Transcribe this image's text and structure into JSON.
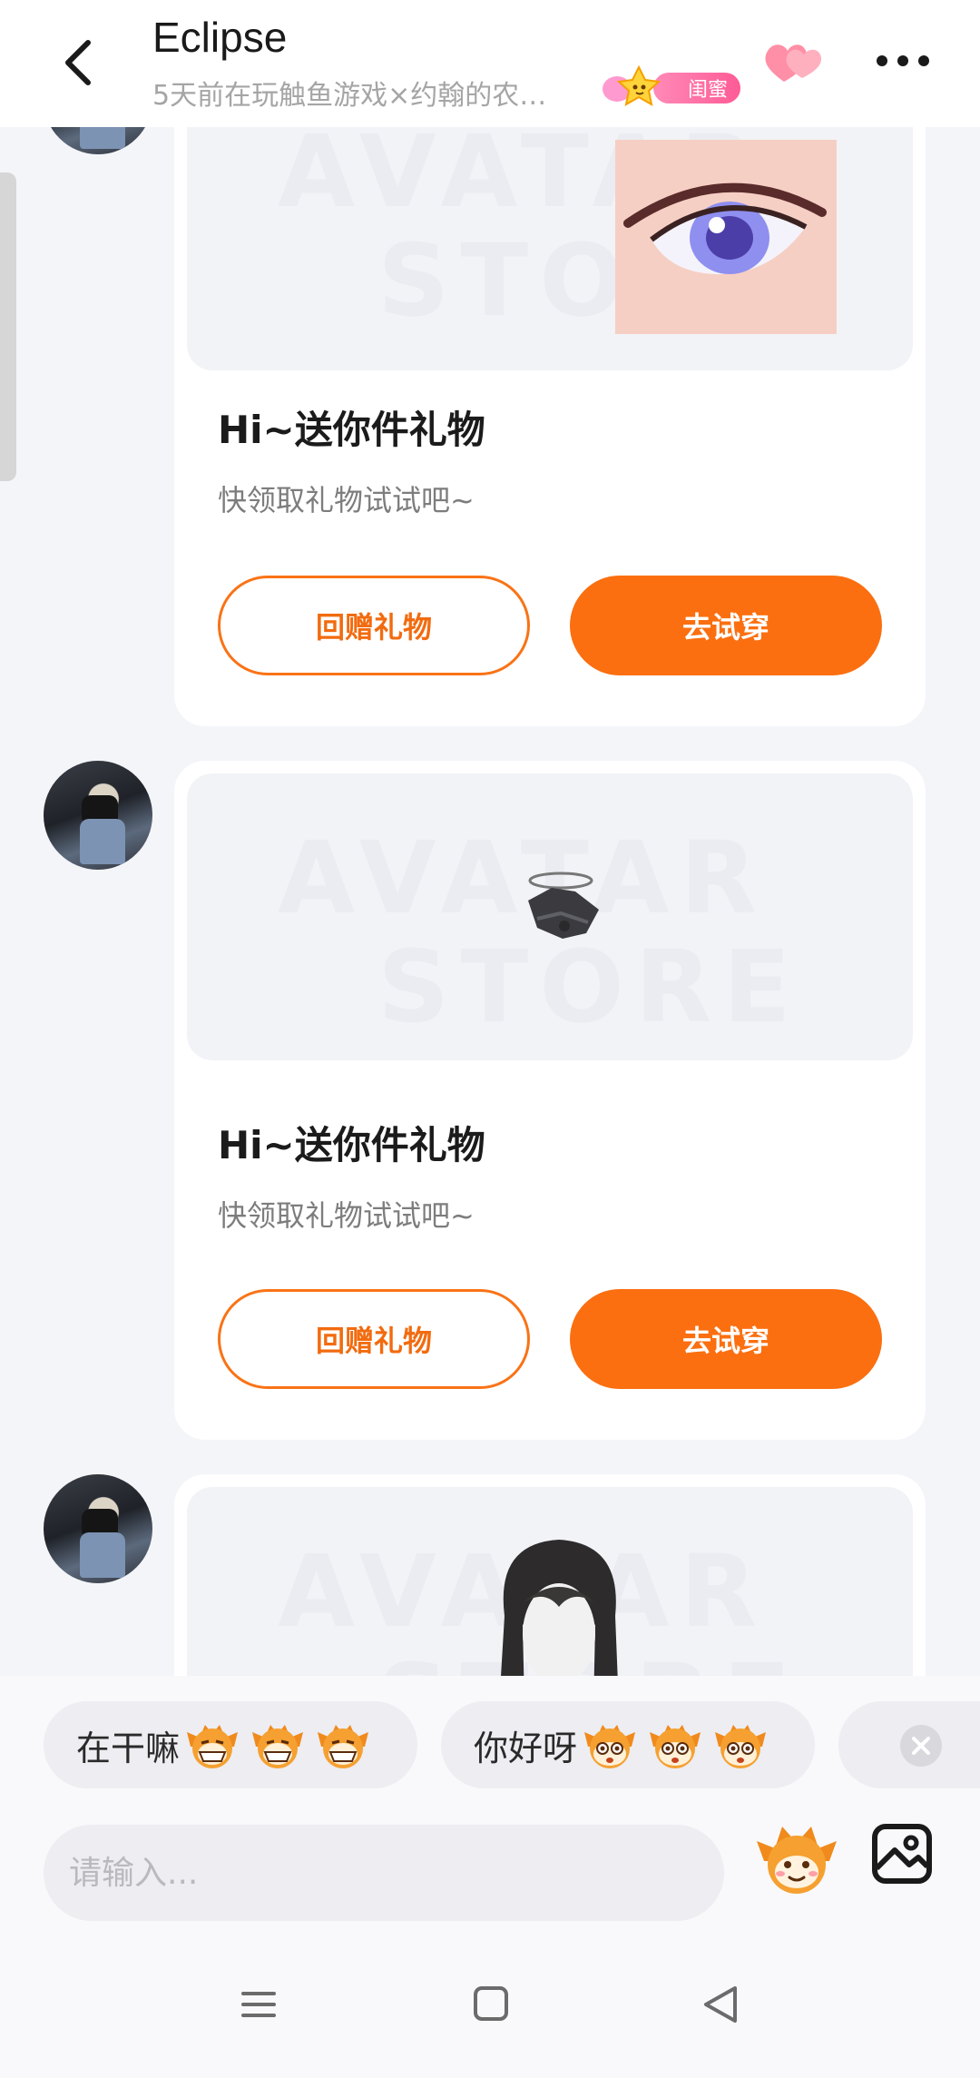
{
  "header": {
    "title": "Eclipse",
    "subtitle": "5天前在玩触鱼游戏×约翰的农…",
    "badge_label": "闺蜜"
  },
  "cards": [
    {
      "title": "Hi~送你件礼物",
      "desc": "快领取礼物试试吧~",
      "return_gift_label": "回赠礼物",
      "try_on_label": "去试穿",
      "item": "eye-item"
    },
    {
      "title": "Hi~送你件礼物",
      "desc": "快领取礼物试试吧~",
      "return_gift_label": "回赠礼物",
      "try_on_label": "去试穿",
      "item": "halo-hat-item"
    },
    {
      "item": "hair-item"
    }
  ],
  "quick_replies": [
    {
      "text": "在干嘛",
      "emoji_count": 3
    },
    {
      "text": "你好呀",
      "emoji_count": 3
    }
  ],
  "input": {
    "placeholder": "请输入..."
  },
  "colors": {
    "accent": "#fb6f10",
    "badge": "#ff5b95"
  }
}
